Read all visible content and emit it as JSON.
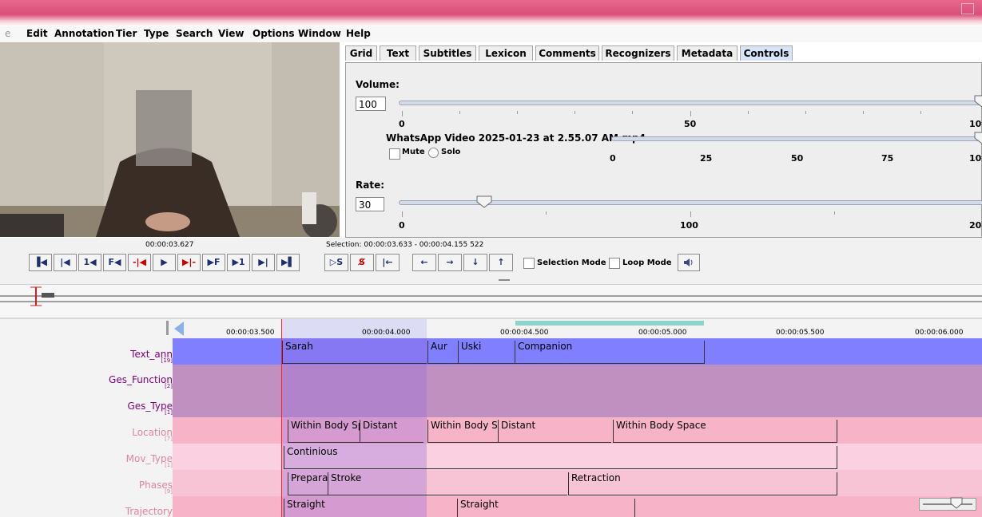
{
  "menu": [
    "e",
    "Edit",
    "Annotation",
    "Tier",
    "Type",
    "Search",
    "View",
    "Options",
    "Window",
    "Help"
  ],
  "tabs": [
    {
      "label": "Grid",
      "active": false
    },
    {
      "label": "Text",
      "active": false
    },
    {
      "label": "Subtitles",
      "active": false
    },
    {
      "label": "Lexicon",
      "active": false
    },
    {
      "label": "Comments",
      "active": false
    },
    {
      "label": "Recognizers",
      "active": false
    },
    {
      "label": "Metadata",
      "active": false
    },
    {
      "label": "Controls",
      "active": true
    }
  ],
  "controls": {
    "volume_label": "Volume:",
    "volume_value": "100",
    "volume_ticks": [
      "0",
      "50",
      "10"
    ],
    "media_file": "WhatsApp Video 2025-01-23 at 2.55.07 AM.mp4",
    "mute_label": "Mute",
    "solo_label": "Solo",
    "file_ticks": [
      "0",
      "25",
      "50",
      "75",
      "10"
    ],
    "rate_label": "Rate:",
    "rate_value": "30",
    "rate_ticks": [
      "0",
      "100",
      "20"
    ]
  },
  "player": {
    "current_time": "00:00:03.627",
    "selection": "Selection: 00:00:03.633 - 00:00:04.155  522",
    "buttons": [
      "▐◀",
      "|◀",
      "1◀",
      "F◀",
      "-|◀",
      "▶",
      "▶|-",
      "▶F",
      "▶1",
      "▶|",
      "▶▌"
    ],
    "sel_buttons": [
      "▷S",
      "S̸",
      "|←",
      "←",
      "→",
      "↓",
      "↑"
    ],
    "selection_mode": "Selection Mode",
    "loop_mode": "Loop Mode"
  },
  "ruler": [
    "00:00:03.500",
    "00:00:04.000",
    "00:00:04.500",
    "00:00:05.000",
    "00:00:05.500",
    "00:00:06.000"
  ],
  "tiers": [
    {
      "name": "Text_ann",
      "count": "[19]",
      "color": "#7f7fff",
      "fg": "#7a007a",
      "anns": [
        "Sarah",
        "Aur",
        "Uski",
        "Companion"
      ]
    },
    {
      "name": "Ges_Function",
      "count": "[2]",
      "color": "#c090c0",
      "fg": "#7a007a",
      "anns": []
    },
    {
      "name": "Ges_Type",
      "count": "[1]",
      "color": "#c090c0",
      "fg": "#7a007a",
      "anns": []
    },
    {
      "name": "Location",
      "count": "[7]",
      "color": "#f7b3c8",
      "fg": "#e084a0",
      "anns": [
        "Within Body Sp",
        "Distant",
        "Within Body Sp",
        "Distant",
        "Within Body Space"
      ]
    },
    {
      "name": "Mov_Type",
      "count": "[1]",
      "color": "#fbd0e0",
      "fg": "#e084a0",
      "anns": [
        "Continious"
      ]
    },
    {
      "name": "Phases",
      "count": "[9]",
      "color": "#f7c4d6",
      "fg": "#e084a0",
      "anns": [
        "Prepara",
        "Stroke",
        "Retraction"
      ]
    },
    {
      "name": "Trajectory",
      "count": "",
      "color": "#f7b3c8",
      "fg": "#e084a0",
      "anns": [
        "Straight",
        "Straight"
      ]
    }
  ],
  "icons": {
    "speaker": "speaker-icon"
  }
}
